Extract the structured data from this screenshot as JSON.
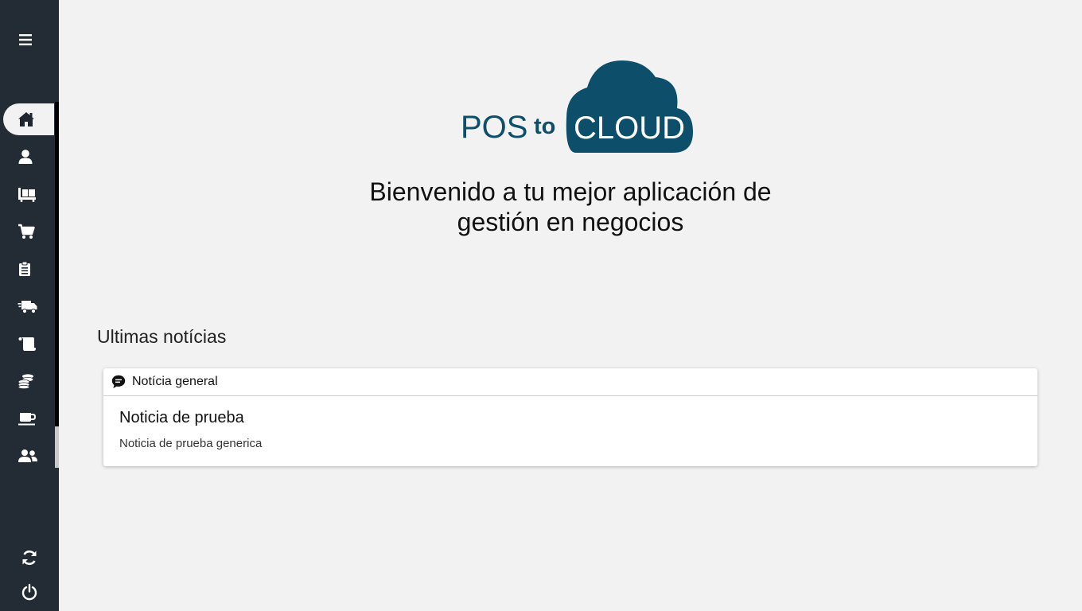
{
  "brand": {
    "word1": "POS",
    "word2": "to",
    "word3": "CLOUD",
    "color": "#0d4f6b"
  },
  "sidebar": {
    "menu_icon": "hamburger-icon",
    "items": [
      {
        "icon": "home-icon",
        "active": true
      },
      {
        "icon": "user-icon",
        "active": false
      },
      {
        "icon": "pallet-boxes-icon",
        "active": false
      },
      {
        "icon": "shopping-cart-icon",
        "active": false
      },
      {
        "icon": "clipboard-list-icon",
        "active": false
      },
      {
        "icon": "shipping-fast-icon",
        "active": false
      },
      {
        "icon": "receipt-scroll-icon",
        "active": false
      },
      {
        "icon": "coins-icon",
        "active": false
      },
      {
        "icon": "coffee-icon",
        "active": false
      },
      {
        "icon": "users-icon",
        "active": false
      }
    ],
    "bottom": [
      {
        "icon": "sync-icon"
      },
      {
        "icon": "power-off-icon"
      }
    ],
    "background": "#232b35"
  },
  "main": {
    "welcome_line1": "Bienvenido a tu mejor aplicación de",
    "welcome_line2": "gestión en negocios",
    "news_heading": "Ultimas notícias",
    "news": [
      {
        "category": "Notícia general",
        "title": "Noticia de prueba",
        "body": "Noticia de prueba generica"
      }
    ]
  }
}
